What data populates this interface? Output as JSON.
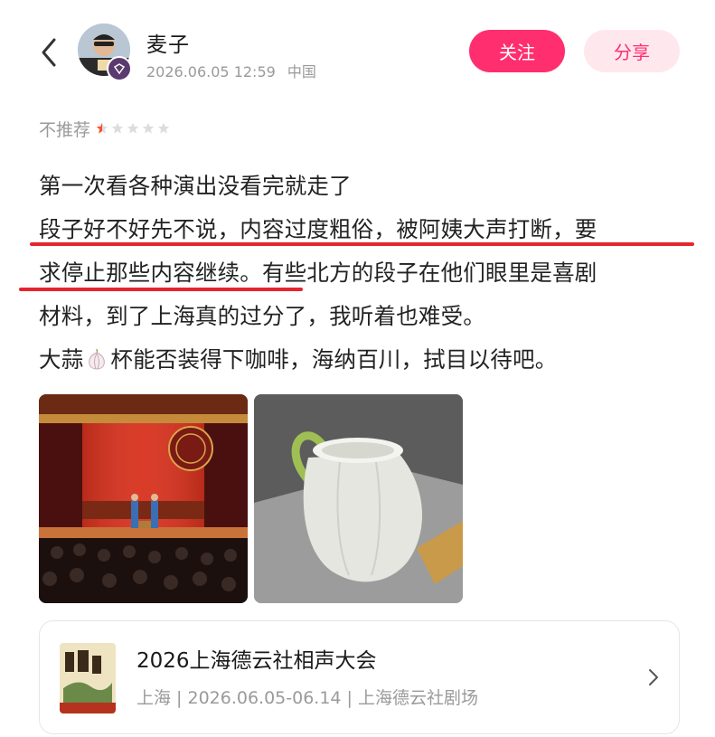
{
  "header": {
    "username": "麦子",
    "date": "2026.06.05 12:59",
    "location": "中国",
    "follow_label": "关注",
    "share_label": "分享"
  },
  "review": {
    "rating_label": "不推荐",
    "rating": 0.5,
    "rating_max": 5,
    "lines": [
      "第一次看各种演出没看完就走了",
      "段子好不好先不说，内容过度粗俗，被阿姨大声打断，要",
      "求停止那些内容继续。有些北方的段子在他们眼里是喜剧",
      "材料，到了上海真的过分了，我听着也难受。"
    ],
    "last_line_before_emoji": "大蒜",
    "last_line_after_emoji": "杯能否装得下咖啡，海纳百川，拭目以待吧。"
  },
  "colors": {
    "accent": "#ff2e6e",
    "accent_soft": "#ffe7ee",
    "underline": "#e8232f",
    "muted_text": "#9a9a9a"
  },
  "event": {
    "title": "2026上海德云社相声大会",
    "subtitle": "上海 | 2026.06.05-06.14 | 上海德云社剧场"
  }
}
